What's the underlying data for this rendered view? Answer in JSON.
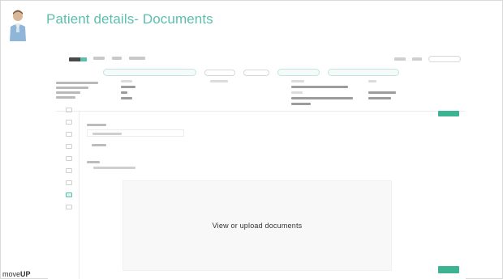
{
  "slide": {
    "title": "Patient details- Documents",
    "brand_prefix": "move",
    "brand_suffix": "UP"
  },
  "main": {
    "drop_text": "View or upload documents"
  },
  "colors": {
    "accent": "#5bbfae",
    "button": "#3cb392"
  },
  "icons": {
    "presenter": "presenter-avatar-icon",
    "sidebar": [
      "home-icon",
      "chart-icon",
      "calendar-icon",
      "pill-icon",
      "chat-icon",
      "exercise-icon",
      "survey-icon",
      "documents-icon",
      "settings-icon"
    ]
  }
}
